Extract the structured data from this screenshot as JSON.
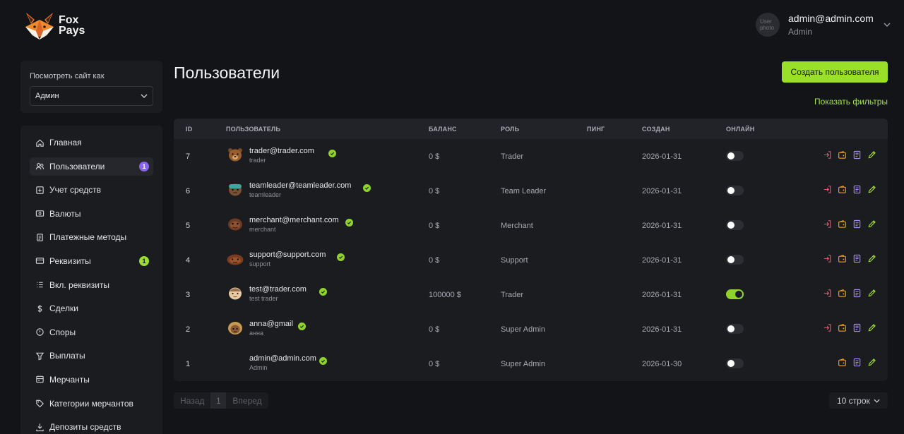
{
  "app": {
    "logo_line1": "Fox",
    "logo_line2": "Pays"
  },
  "user_menu": {
    "email": "admin@admin.com",
    "role": "Admin",
    "avatar_alt_line1": "User",
    "avatar_alt_line2": "photo"
  },
  "view_as": {
    "label": "Посмотреть сайт как",
    "selected": "Админ"
  },
  "sidebar": {
    "items": [
      {
        "label": "Главная",
        "icon": "home-icon"
      },
      {
        "label": "Пользователи",
        "icon": "users-icon",
        "badge": "1",
        "active": true
      },
      {
        "label": "Учет средств",
        "icon": "funds-icon"
      },
      {
        "label": "Валюты",
        "icon": "currency-icon"
      },
      {
        "label": "Платежные методы",
        "icon": "payment-methods-icon"
      },
      {
        "label": "Реквизиты",
        "icon": "card-icon",
        "badge": "1"
      },
      {
        "label": "Вкл. реквизиты",
        "icon": "list-icon"
      },
      {
        "label": "Сделки",
        "icon": "dollar-icon"
      },
      {
        "label": "Споры",
        "icon": "dispute-icon"
      },
      {
        "label": "Выплаты",
        "icon": "payouts-icon"
      },
      {
        "label": "Мерчанты",
        "icon": "merchant-icon"
      },
      {
        "label": "Категории мерчантов",
        "icon": "categories-icon"
      },
      {
        "label": "Депозиты средств",
        "icon": "deposit-icon"
      }
    ]
  },
  "page": {
    "title": "Пользователи",
    "create_button": "Создать пользователя",
    "filters_link": "Показать фильтры"
  },
  "table": {
    "headers": {
      "id": "ID",
      "user": "ПОЛЬЗОВАТЕЛЬ",
      "balance": "БАЛАНС",
      "role": "РОЛЬ",
      "ping": "ПИНГ",
      "created": "СОЗДАН",
      "online": "ОНЛАЙН"
    },
    "rows": [
      {
        "id": "7",
        "email": "trader@trader.com",
        "name": "trader",
        "balance": "0 $",
        "role": "Trader",
        "ping": "",
        "created": "2026-01-31",
        "online": false,
        "avatar": "bear",
        "login_as": true
      },
      {
        "id": "6",
        "email": "teamleader@teamleader.com",
        "name": "teamleader",
        "balance": "0 $",
        "role": "Team Leader",
        "ping": "",
        "created": "2026-01-31",
        "online": false,
        "avatar": "teal",
        "login_as": true
      },
      {
        "id": "5",
        "email": "merchant@merchant.com",
        "name": "merchant",
        "balance": "0 $",
        "role": "Merchant",
        "ping": "",
        "created": "2026-01-31",
        "online": false,
        "avatar": "brown",
        "login_as": true
      },
      {
        "id": "4",
        "email": "support@support.com",
        "name": "support",
        "balance": "0 $",
        "role": "Support",
        "ping": "",
        "created": "2026-01-31",
        "online": false,
        "avatar": "wide",
        "login_as": true
      },
      {
        "id": "3",
        "email": "test@trader.com",
        "name": "test trader",
        "balance": "100000 $",
        "role": "Trader",
        "ping": "",
        "created": "2026-01-31",
        "online": true,
        "avatar": "light",
        "login_as": true
      },
      {
        "id": "2",
        "email": "anna@gmail",
        "name": "анна",
        "balance": "0 $",
        "role": "Super Admin",
        "ping": "",
        "created": "2026-01-31",
        "online": false,
        "avatar": "blond",
        "login_as": true
      },
      {
        "id": "1",
        "email": "admin@admin.com",
        "name": "Admin",
        "balance": "0 $",
        "role": "Super Admin",
        "ping": "",
        "created": "2026-01-30",
        "online": false,
        "avatar": "none",
        "login_as": false
      }
    ]
  },
  "pagination": {
    "prev": "Назад",
    "page": "1",
    "next": "Вперед",
    "rows_per_page": "10 строк"
  },
  "colors": {
    "accent": "#9ae028",
    "badge_purple": "#8a63f0",
    "bg": "#131417",
    "card": "#1b1c20"
  }
}
